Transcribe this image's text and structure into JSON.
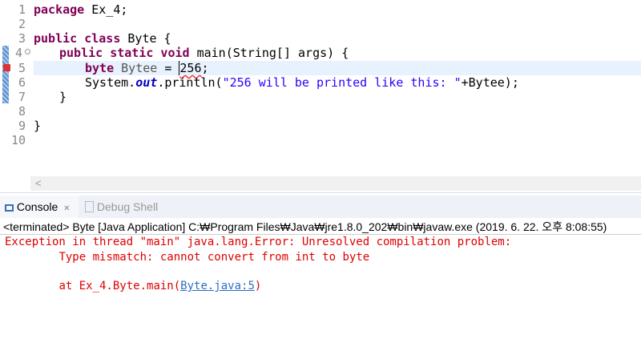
{
  "editor": {
    "lines": [
      "1",
      "2",
      "3",
      "4",
      "5",
      "6",
      "7",
      "8",
      "9",
      "10"
    ],
    "code": {
      "l1_kw": "package",
      "l1_rest": " Ex_4;",
      "l3_kw": "public class",
      "l3_rest": " Byte {",
      "l4_kw": "public static void",
      "l4_rest": " main(String[] args) {",
      "l5_kw": "byte",
      "l5_var": " Bytee",
      "l5_eq": " = ",
      "l5_num": "256",
      "l5_end": ";",
      "l6_a": "System.",
      "l6_out": "out",
      "l6_b": ".println(",
      "l6_str": "\"256 will be printed like this: \"",
      "l6_c": "+Bytee);",
      "l7": "}",
      "l9": "}"
    },
    "scroll_left": "<"
  },
  "tabs": {
    "console": "Console",
    "console_close": "✕",
    "debug": "Debug Shell"
  },
  "console": {
    "title": "<terminated> Byte [Java Application] C:₩Program Files₩Java₩jre1.8.0_202₩bin₩javaw.exe (2019. 6. 22. 오후 8:08:55)",
    "line1": "Exception in thread \"main\" java.lang.Error: Unresolved compilation problem: ",
    "line2": "\tType mismatch: cannot convert from int to byte",
    "line3_pre": "\tat Ex_4.Byte.main(",
    "line3_link": "Byte.java:5",
    "line3_post": ")"
  }
}
